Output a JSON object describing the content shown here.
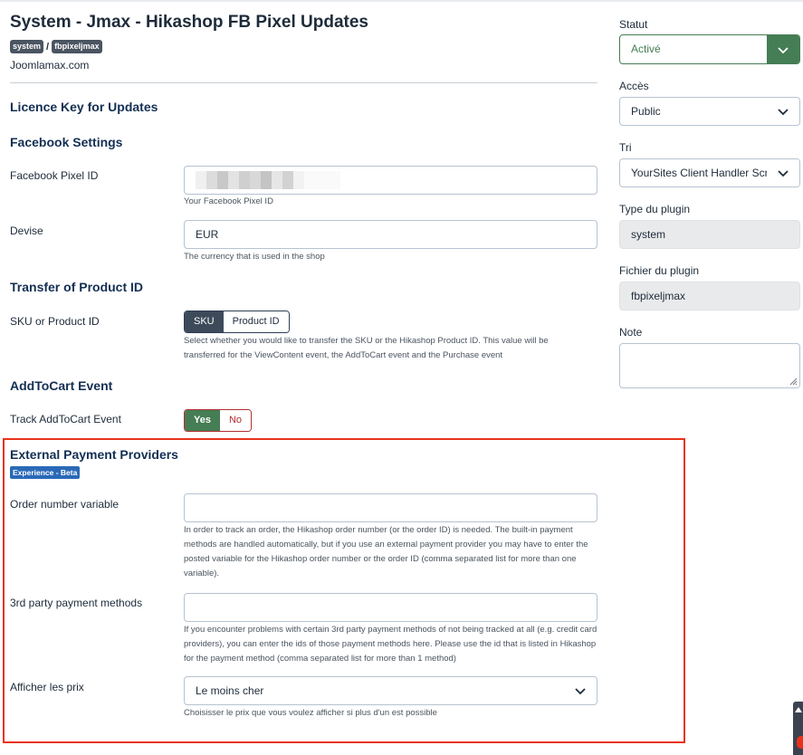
{
  "header": {
    "title": "System - Jmax - Hikashop FB Pixel Updates",
    "tag_system": "system",
    "tag_separator": "/",
    "tag_element": "fbpixeljmax",
    "author": "Joomlamax.com"
  },
  "sections": {
    "licence": "Licence Key for Updates",
    "facebook": "Facebook Settings",
    "transfer": "Transfer of Product ID",
    "addtocart": "AddToCart Event",
    "external": "External Payment Providers",
    "external_badge": "Experience - Beta"
  },
  "fields": {
    "pixel_id": {
      "label": "Facebook Pixel ID",
      "value": "",
      "help": "Your Facebook Pixel ID"
    },
    "currency": {
      "label": "Devise",
      "value": "EUR",
      "help": "The currency that is used in the shop"
    },
    "sku": {
      "label": "SKU or Product ID",
      "options": [
        "SKU",
        "Product ID"
      ],
      "selected": "SKU",
      "help": "Select whether you would like to transfer the SKU or the Hikashop Product ID. This value will be transferred for the ViewContent event, the AddToCart event and the Purchase event"
    },
    "track_addtocart": {
      "label": "Track AddToCart Event",
      "yes": "Yes",
      "no": "No",
      "selected": "Yes"
    },
    "order_number": {
      "label": "Order number variable",
      "value": "",
      "help": "In order to track an order, the Hikashop order number (or the order ID) is needed. The built-in payment methods are handled automatically, but if you use an external payment provider you may have to enter the posted variable for the Hikashop order number or the order ID (comma separated list for more than one variable)."
    },
    "third_party": {
      "label": "3rd party payment methods",
      "value": "",
      "help": "If you encounter problems with certain 3rd party payment methods of not being tracked at all (e.g. credit card providers), you can enter the ids of those payment methods here. Please use the id that is listed in Hikashop for the payment method (comma separated list for more than 1 method)"
    },
    "show_prices": {
      "label": "Afficher les prix",
      "value": "Le moins cher",
      "help": "Choisisser le prix que vous voulez afficher si plus d'un est possible"
    }
  },
  "sidebar": {
    "status_label": "Statut",
    "status_value": "Activé",
    "access_label": "Accès",
    "access_value": "Public",
    "order_label": "Tri",
    "order_value": "YourSites Client Handler Script",
    "plugin_type_label": "Type du plugin",
    "plugin_type_value": "system",
    "plugin_file_label": "Fichier du plugin",
    "plugin_file_value": "fbpixeljmax",
    "note_label": "Note",
    "note_value": ""
  },
  "colors": {
    "accent_green": "#457d54",
    "highlight_red": "#e8331c",
    "beta_blue": "#2a69b8",
    "heading_navy": "#132f53"
  }
}
